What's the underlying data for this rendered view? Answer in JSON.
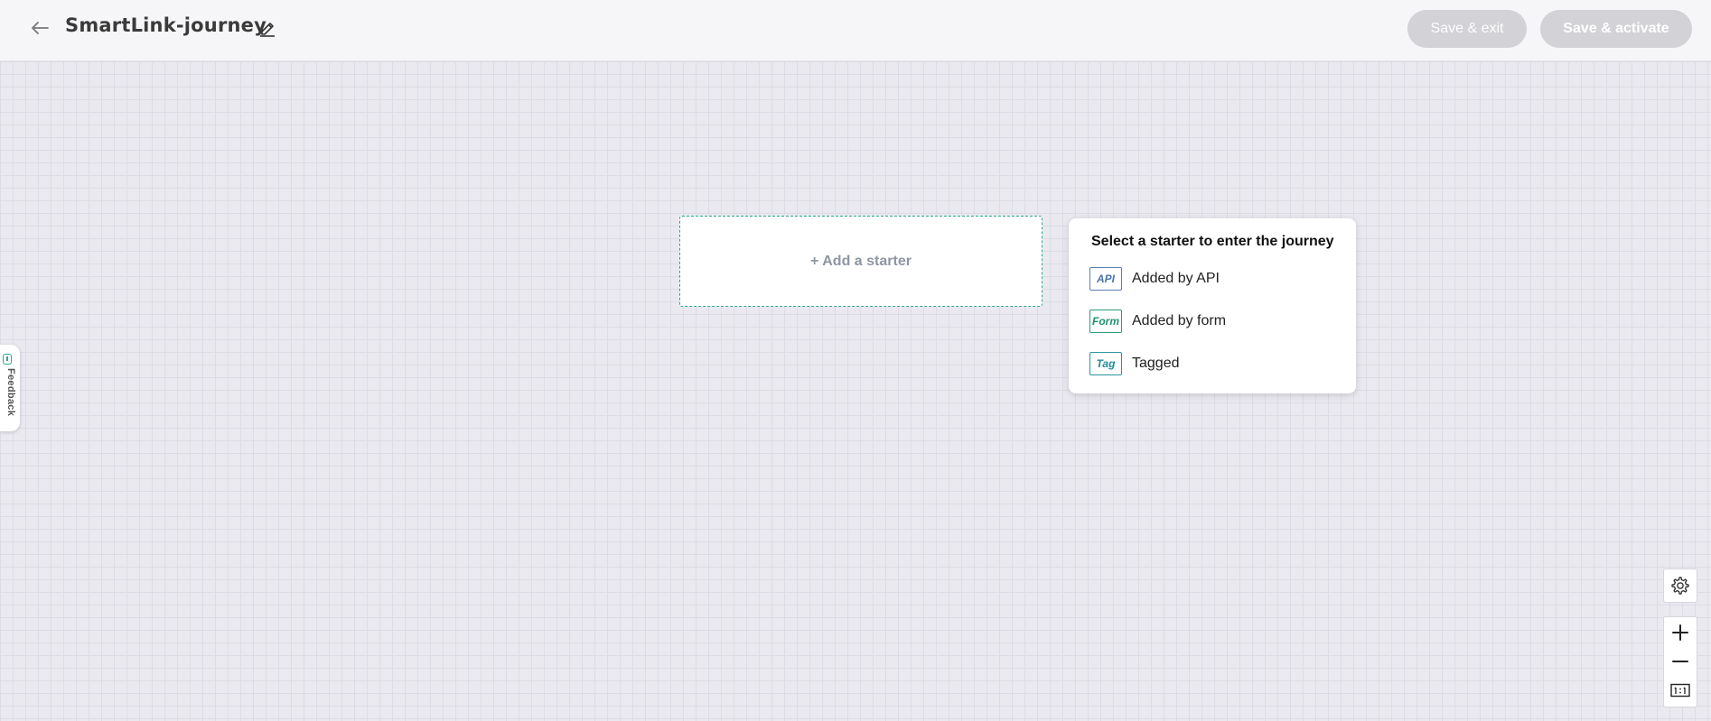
{
  "header": {
    "title": "SmartLink-journey",
    "back_icon": "arrow-left-icon",
    "edit_icon": "pencil-icon",
    "save_exit_label": "Save & exit",
    "save_activate_label": "Save & activate"
  },
  "canvas": {
    "add_starter_label": "+ Add a starter"
  },
  "starter_popup": {
    "title": "Select a starter to enter the journey",
    "options": [
      {
        "badge": "API",
        "label": "Added by API",
        "color": "#4c74a8"
      },
      {
        "badge": "Form",
        "label": "Added by form",
        "color": "#1f9170"
      },
      {
        "badge": "Tag",
        "label": "Tagged",
        "color": "#1f8a96"
      }
    ]
  },
  "feedback": {
    "label": "Feedback"
  },
  "colors": {
    "accent": "#2aa68c",
    "disabled_button": "#d2d2d7",
    "canvas_bg": "#eae9ef"
  }
}
